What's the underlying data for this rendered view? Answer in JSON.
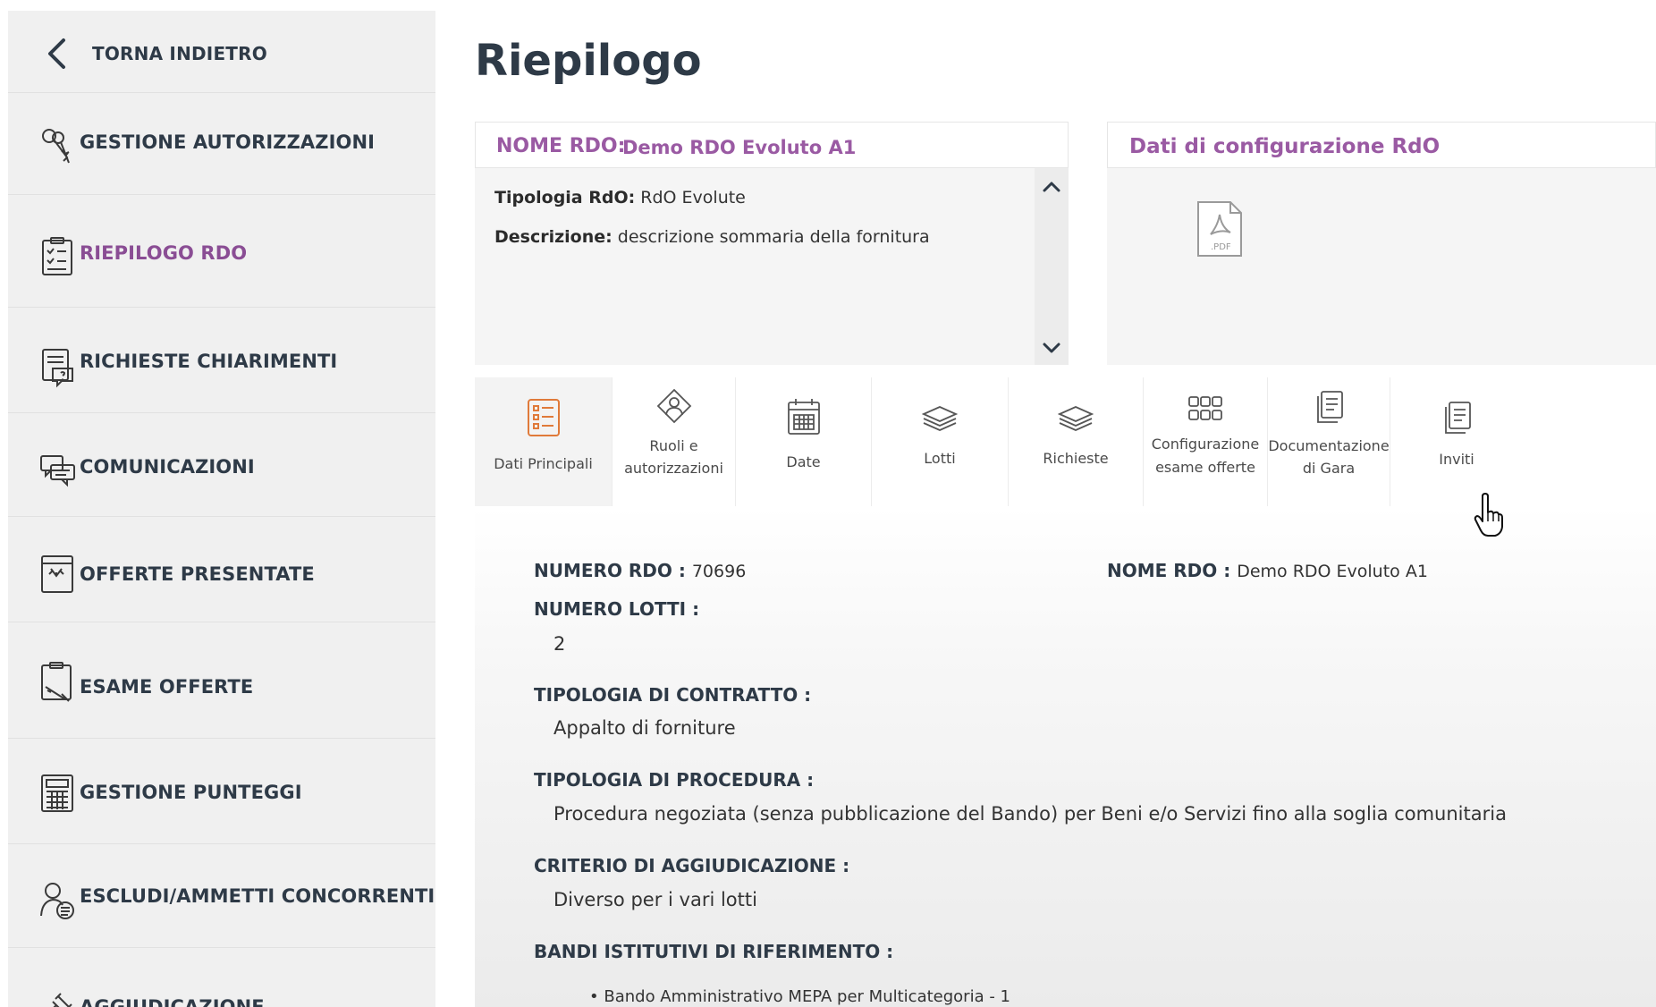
{
  "sidebar": {
    "back_label": "TORNA INDIETRO",
    "items": [
      {
        "label": "GESTIONE AUTORIZZAZIONI",
        "icon": "keys-icon",
        "active": false
      },
      {
        "label": "RIEPILOGO RDO",
        "icon": "clipboard-checklist-icon",
        "active": true
      },
      {
        "label": "RICHIESTE CHIARIMENTI",
        "icon": "document-question-icon",
        "active": false
      },
      {
        "label": "COMUNICAZIONI",
        "icon": "chat-bubbles-icon",
        "active": false
      },
      {
        "label": "OFFERTE PRESENTATE",
        "icon": "offer-box-icon",
        "active": false
      },
      {
        "label": "ESAME OFFERTE",
        "icon": "clipboard-pen-icon",
        "active": false
      },
      {
        "label": "GESTIONE PUNTEGGI",
        "icon": "calculator-icon",
        "active": false
      },
      {
        "label": "ESCLUDI/AMMETTI CONCORRENTI",
        "icon": "user-list-icon",
        "active": false
      },
      {
        "label": "AGGIUDICAZIONE",
        "icon": "gavel-icon",
        "active": false
      }
    ]
  },
  "main": {
    "title": "Riepilogo",
    "summary_card": {
      "key": "NOME RDO:",
      "value": "Demo RDO Evoluto A1",
      "tipologia_key": "Tipologia RdO:",
      "tipologia_value": "RdO Evolute",
      "descrizione_key": "Descrizione:",
      "descrizione_value": "descrizione sommaria della fornitura"
    },
    "config_card": {
      "title": "Dati di configurazione RdO",
      "file_label": ".PDF"
    },
    "tabs": [
      {
        "label_1": "Dati Principali",
        "label_2": "",
        "icon": "list-form-icon",
        "active": true
      },
      {
        "label_1": "Ruoli e",
        "label_2": "autorizzazioni",
        "icon": "user-roles-icon",
        "active": false
      },
      {
        "label_1": "Date",
        "label_2": "",
        "icon": "calendar-icon",
        "active": false
      },
      {
        "label_1": "Lotti",
        "label_2": "",
        "icon": "layers-icon",
        "active": false
      },
      {
        "label_1": "Richieste",
        "label_2": "",
        "icon": "layers-icon",
        "active": false
      },
      {
        "label_1": "Configurazione",
        "label_2": "esame offerte",
        "icon": "grid-icon",
        "active": false
      },
      {
        "label_1": "Documentazione",
        "label_2": "di Gara",
        "icon": "documents-icon",
        "active": false
      },
      {
        "label_1": "Inviti",
        "label_2": "",
        "icon": "documents-icon",
        "active": false
      }
    ],
    "details": {
      "numero_rdo_key": "NUMERO RDO :",
      "numero_rdo_value": "70696",
      "nome_rdo_key": "NOME RDO :",
      "nome_rdo_value": "Demo RDO Evoluto A1",
      "numero_lotti_key": "NUMERO LOTTI :",
      "numero_lotti_value": "2",
      "contratto_key": "TIPOLOGIA DI CONTRATTO :",
      "contratto_value": "Appalto di forniture",
      "procedura_key": "TIPOLOGIA DI PROCEDURA :",
      "procedura_value": "Procedura negoziata (senza pubblicazione del Bando) per Beni e/o Servizi fino alla soglia comunitaria",
      "criterio_key": "CRITERIO DI AGGIUDICAZIONE :",
      "criterio_value": "Diverso per i vari lotti",
      "bandi_key": "BANDI ISTITUTIVI DI RIFERIMENTO :",
      "bandi_items": [
        "Bando Amministrativo MEPA per Multicategoria - 1"
      ]
    }
  },
  "colors": {
    "accent_purple": "#9a5aa3",
    "active_nav": "#8a4d94",
    "text_dark": "#2e3a47",
    "tab_icon_orange": "#e07a3a"
  }
}
